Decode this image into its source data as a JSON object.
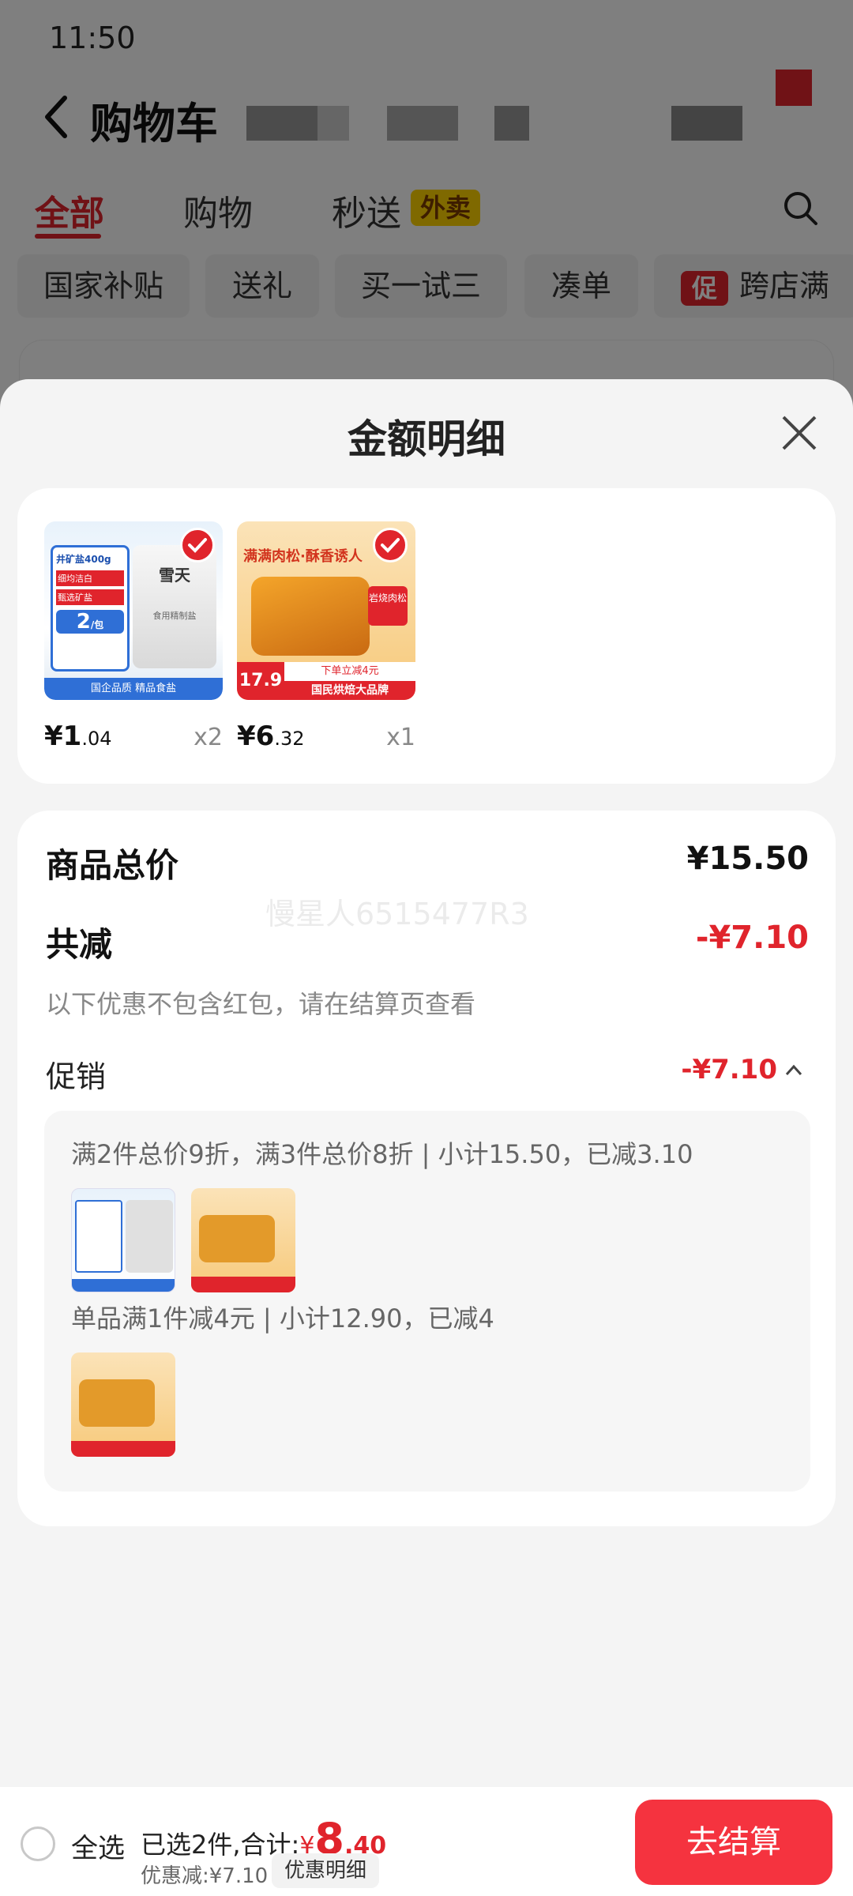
{
  "status_bar": {
    "time": "11:50"
  },
  "header": {
    "title": "购物车"
  },
  "tabs": [
    {
      "label": "全部"
    },
    {
      "label": "购物"
    },
    {
      "label": "秒送",
      "badge": "外卖"
    }
  ],
  "filter_chips": [
    "国家补贴",
    "送礼",
    "买一试三",
    "凑单",
    "跨店满"
  ],
  "promo_tag": "促",
  "sheet": {
    "title": "金额明细",
    "products": [
      {
        "price_main": "¥1",
        "price_dec": ".04",
        "qty": "x2",
        "image_text": [
          "井矿盐400g",
          "雪天",
          "细均洁白",
          "甄选矿盐",
          "2",
          "/包",
          "国企品质",
          "精品食盐",
          "食用精制盐"
        ]
      },
      {
        "price_main": "¥6",
        "price_dec": ".32",
        "qty": "x1",
        "image_text": [
          "满满肉松·酥香诱人",
          "岩烧肉松",
          "17.9",
          "下单立减4元",
          "国民烘焙大品牌"
        ]
      }
    ],
    "summary": {
      "total_label": "商品总价",
      "total_value": "¥15.50",
      "watermark": "慢星人6515477R3",
      "discount_label": "共减",
      "discount_value": "-¥7.10",
      "note": "以下优惠不包含红包，请在结算页查看",
      "promo_label": "促销",
      "promo_value": "-¥7.10",
      "promo_lines": [
        "满2件总价9折，满3件总价8折 | 小计15.50，已减3.10",
        "单品满1件减4元 | 小计12.90，已减4"
      ]
    }
  },
  "bottom_bar": {
    "select_all": "全选",
    "selected_prefix": "已选2件,合计:",
    "total_yen": "¥",
    "total_int": "8",
    "total_dec": ".40",
    "saved": "优惠减:¥7.10",
    "detail_button": "优惠明细",
    "checkout_button": "去结算"
  },
  "colors": {
    "accent": "#e0242c",
    "checkout": "#f5333f"
  }
}
